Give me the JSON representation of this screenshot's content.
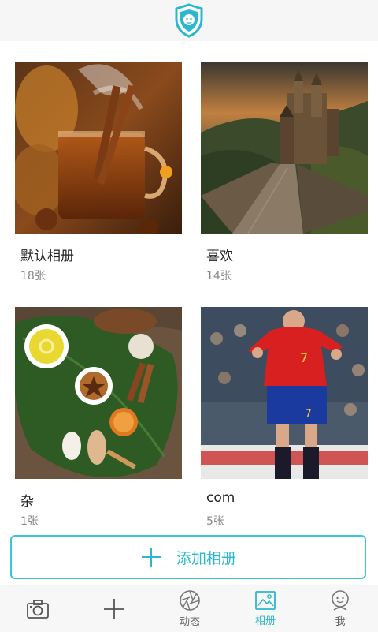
{
  "albums": [
    {
      "name": "默认相册",
      "count": "18张",
      "image": "tea-photo"
    },
    {
      "name": "喜欢",
      "count": "14张",
      "image": "castle-photo"
    },
    {
      "name": "杂",
      "count": "1张",
      "image": "spa-herbs-photo"
    },
    {
      "name": "com",
      "count": "5张",
      "image": "soccer-player-photo"
    }
  ],
  "add_album_label": "添加相册",
  "tabs": [
    {
      "label": "",
      "icon": "camera-icon"
    },
    {
      "label": "",
      "icon": "plus-icon"
    },
    {
      "label": "动态",
      "icon": "aperture-icon"
    },
    {
      "label": "相册",
      "icon": "album-icon"
    },
    {
      "label": "我",
      "icon": "profile-icon"
    }
  ],
  "colors": {
    "accent": "#2cb8cc",
    "tab_inactive": "#666666"
  }
}
